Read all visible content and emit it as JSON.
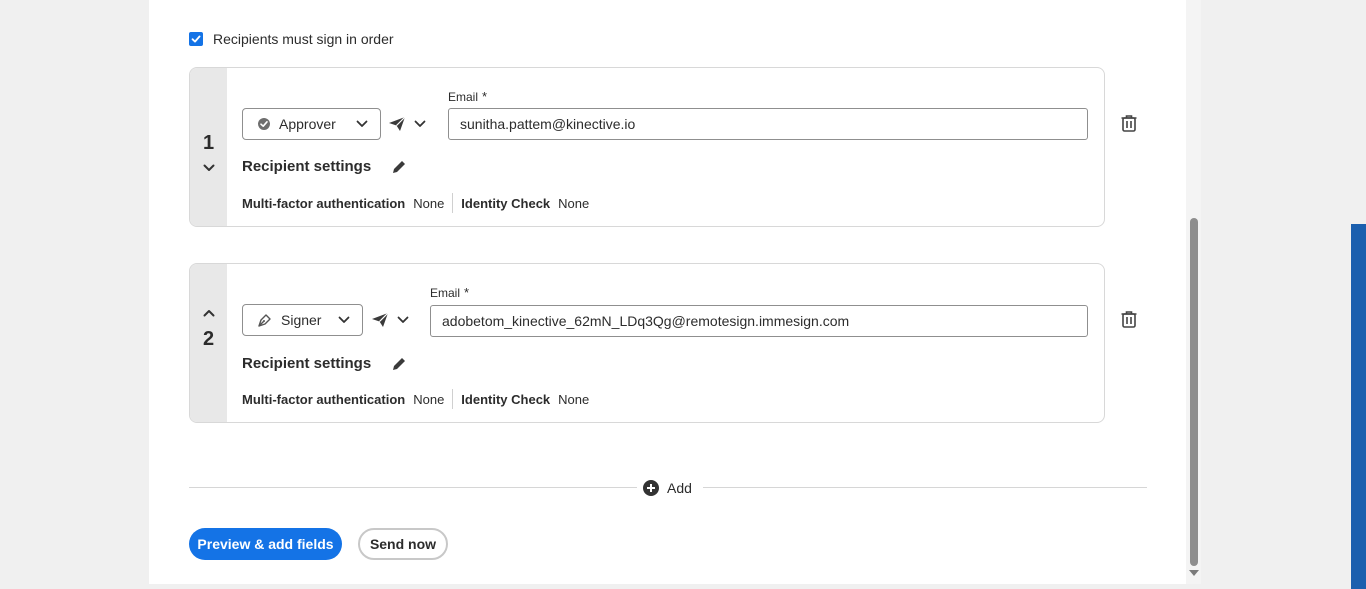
{
  "order": {
    "checked": true,
    "label": "Recipients must sign in order"
  },
  "recipients": [
    {
      "number": "1",
      "role": "Approver",
      "role_icon": "check-circle-icon",
      "email_label": "Email",
      "required_mark": "*",
      "email": "sunitha.pattem@kinective.io",
      "settings_title": "Recipient settings",
      "mfa_label": "Multi-factor authentication",
      "mfa_value": "None",
      "identity_label": "Identity Check",
      "identity_value": "None"
    },
    {
      "number": "2",
      "role": "Signer",
      "role_icon": "pen-nib-icon",
      "email_label": "Email",
      "required_mark": "*",
      "email": "adobetom_kinective_62mN_LDq3Qg@remotesign.immesign.com",
      "settings_title": "Recipient settings",
      "mfa_label": "Multi-factor authentication",
      "mfa_value": "None",
      "identity_label": "Identity Check",
      "identity_value": "None"
    }
  ],
  "add": {
    "label": "Add"
  },
  "actions": {
    "preview_label": "Preview & add fields",
    "send_label": "Send now"
  },
  "colors": {
    "accent": "#1473e6",
    "side_strip": "#e8e8e8",
    "page_bg": "#f0f0f0"
  }
}
